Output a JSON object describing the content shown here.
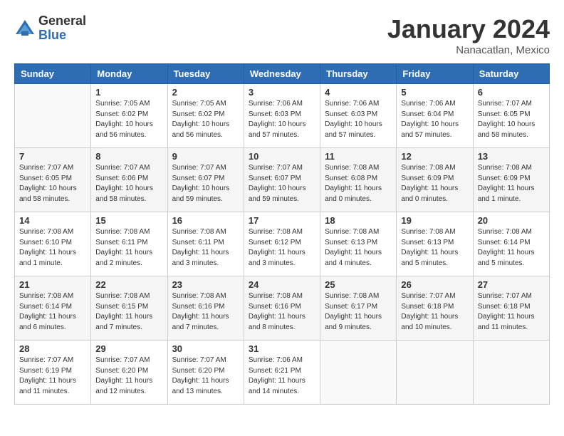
{
  "logo": {
    "general": "General",
    "blue": "Blue"
  },
  "header": {
    "month_year": "January 2024",
    "location": "Nanacatlan, Mexico"
  },
  "weekdays": [
    "Sunday",
    "Monday",
    "Tuesday",
    "Wednesday",
    "Thursday",
    "Friday",
    "Saturday"
  ],
  "weeks": [
    [
      {
        "day": "",
        "info": ""
      },
      {
        "day": "1",
        "info": "Sunrise: 7:05 AM\nSunset: 6:02 PM\nDaylight: 10 hours\nand 56 minutes."
      },
      {
        "day": "2",
        "info": "Sunrise: 7:05 AM\nSunset: 6:02 PM\nDaylight: 10 hours\nand 56 minutes."
      },
      {
        "day": "3",
        "info": "Sunrise: 7:06 AM\nSunset: 6:03 PM\nDaylight: 10 hours\nand 57 minutes."
      },
      {
        "day": "4",
        "info": "Sunrise: 7:06 AM\nSunset: 6:03 PM\nDaylight: 10 hours\nand 57 minutes."
      },
      {
        "day": "5",
        "info": "Sunrise: 7:06 AM\nSunset: 6:04 PM\nDaylight: 10 hours\nand 57 minutes."
      },
      {
        "day": "6",
        "info": "Sunrise: 7:07 AM\nSunset: 6:05 PM\nDaylight: 10 hours\nand 58 minutes."
      }
    ],
    [
      {
        "day": "7",
        "info": "Sunrise: 7:07 AM\nSunset: 6:05 PM\nDaylight: 10 hours\nand 58 minutes."
      },
      {
        "day": "8",
        "info": "Sunrise: 7:07 AM\nSunset: 6:06 PM\nDaylight: 10 hours\nand 58 minutes."
      },
      {
        "day": "9",
        "info": "Sunrise: 7:07 AM\nSunset: 6:07 PM\nDaylight: 10 hours\nand 59 minutes."
      },
      {
        "day": "10",
        "info": "Sunrise: 7:07 AM\nSunset: 6:07 PM\nDaylight: 10 hours\nand 59 minutes."
      },
      {
        "day": "11",
        "info": "Sunrise: 7:08 AM\nSunset: 6:08 PM\nDaylight: 11 hours\nand 0 minutes."
      },
      {
        "day": "12",
        "info": "Sunrise: 7:08 AM\nSunset: 6:09 PM\nDaylight: 11 hours\nand 0 minutes."
      },
      {
        "day": "13",
        "info": "Sunrise: 7:08 AM\nSunset: 6:09 PM\nDaylight: 11 hours\nand 1 minute."
      }
    ],
    [
      {
        "day": "14",
        "info": "Sunrise: 7:08 AM\nSunset: 6:10 PM\nDaylight: 11 hours\nand 1 minute."
      },
      {
        "day": "15",
        "info": "Sunrise: 7:08 AM\nSunset: 6:11 PM\nDaylight: 11 hours\nand 2 minutes."
      },
      {
        "day": "16",
        "info": "Sunrise: 7:08 AM\nSunset: 6:11 PM\nDaylight: 11 hours\nand 3 minutes."
      },
      {
        "day": "17",
        "info": "Sunrise: 7:08 AM\nSunset: 6:12 PM\nDaylight: 11 hours\nand 3 minutes."
      },
      {
        "day": "18",
        "info": "Sunrise: 7:08 AM\nSunset: 6:13 PM\nDaylight: 11 hours\nand 4 minutes."
      },
      {
        "day": "19",
        "info": "Sunrise: 7:08 AM\nSunset: 6:13 PM\nDaylight: 11 hours\nand 5 minutes."
      },
      {
        "day": "20",
        "info": "Sunrise: 7:08 AM\nSunset: 6:14 PM\nDaylight: 11 hours\nand 5 minutes."
      }
    ],
    [
      {
        "day": "21",
        "info": "Sunrise: 7:08 AM\nSunset: 6:14 PM\nDaylight: 11 hours\nand 6 minutes."
      },
      {
        "day": "22",
        "info": "Sunrise: 7:08 AM\nSunset: 6:15 PM\nDaylight: 11 hours\nand 7 minutes."
      },
      {
        "day": "23",
        "info": "Sunrise: 7:08 AM\nSunset: 6:16 PM\nDaylight: 11 hours\nand 7 minutes."
      },
      {
        "day": "24",
        "info": "Sunrise: 7:08 AM\nSunset: 6:16 PM\nDaylight: 11 hours\nand 8 minutes."
      },
      {
        "day": "25",
        "info": "Sunrise: 7:08 AM\nSunset: 6:17 PM\nDaylight: 11 hours\nand 9 minutes."
      },
      {
        "day": "26",
        "info": "Sunrise: 7:07 AM\nSunset: 6:18 PM\nDaylight: 11 hours\nand 10 minutes."
      },
      {
        "day": "27",
        "info": "Sunrise: 7:07 AM\nSunset: 6:18 PM\nDaylight: 11 hours\nand 11 minutes."
      }
    ],
    [
      {
        "day": "28",
        "info": "Sunrise: 7:07 AM\nSunset: 6:19 PM\nDaylight: 11 hours\nand 11 minutes."
      },
      {
        "day": "29",
        "info": "Sunrise: 7:07 AM\nSunset: 6:20 PM\nDaylight: 11 hours\nand 12 minutes."
      },
      {
        "day": "30",
        "info": "Sunrise: 7:07 AM\nSunset: 6:20 PM\nDaylight: 11 hours\nand 13 minutes."
      },
      {
        "day": "31",
        "info": "Sunrise: 7:06 AM\nSunset: 6:21 PM\nDaylight: 11 hours\nand 14 minutes."
      },
      {
        "day": "",
        "info": ""
      },
      {
        "day": "",
        "info": ""
      },
      {
        "day": "",
        "info": ""
      }
    ]
  ]
}
